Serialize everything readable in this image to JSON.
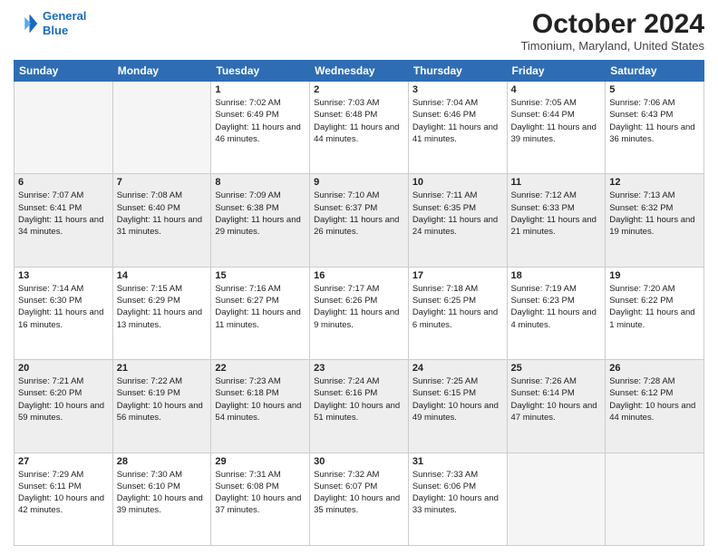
{
  "logo": {
    "line1": "General",
    "line2": "Blue"
  },
  "header": {
    "month": "October 2024",
    "location": "Timonium, Maryland, United States"
  },
  "weekdays": [
    "Sunday",
    "Monday",
    "Tuesday",
    "Wednesday",
    "Thursday",
    "Friday",
    "Saturday"
  ],
  "weeks": [
    [
      {
        "day": "",
        "sunrise": "",
        "sunset": "",
        "daylight": ""
      },
      {
        "day": "",
        "sunrise": "",
        "sunset": "",
        "daylight": ""
      },
      {
        "day": "1",
        "sunrise": "Sunrise: 7:02 AM",
        "sunset": "Sunset: 6:49 PM",
        "daylight": "Daylight: 11 hours and 46 minutes."
      },
      {
        "day": "2",
        "sunrise": "Sunrise: 7:03 AM",
        "sunset": "Sunset: 6:48 PM",
        "daylight": "Daylight: 11 hours and 44 minutes."
      },
      {
        "day": "3",
        "sunrise": "Sunrise: 7:04 AM",
        "sunset": "Sunset: 6:46 PM",
        "daylight": "Daylight: 11 hours and 41 minutes."
      },
      {
        "day": "4",
        "sunrise": "Sunrise: 7:05 AM",
        "sunset": "Sunset: 6:44 PM",
        "daylight": "Daylight: 11 hours and 39 minutes."
      },
      {
        "day": "5",
        "sunrise": "Sunrise: 7:06 AM",
        "sunset": "Sunset: 6:43 PM",
        "daylight": "Daylight: 11 hours and 36 minutes."
      }
    ],
    [
      {
        "day": "6",
        "sunrise": "Sunrise: 7:07 AM",
        "sunset": "Sunset: 6:41 PM",
        "daylight": "Daylight: 11 hours and 34 minutes."
      },
      {
        "day": "7",
        "sunrise": "Sunrise: 7:08 AM",
        "sunset": "Sunset: 6:40 PM",
        "daylight": "Daylight: 11 hours and 31 minutes."
      },
      {
        "day": "8",
        "sunrise": "Sunrise: 7:09 AM",
        "sunset": "Sunset: 6:38 PM",
        "daylight": "Daylight: 11 hours and 29 minutes."
      },
      {
        "day": "9",
        "sunrise": "Sunrise: 7:10 AM",
        "sunset": "Sunset: 6:37 PM",
        "daylight": "Daylight: 11 hours and 26 minutes."
      },
      {
        "day": "10",
        "sunrise": "Sunrise: 7:11 AM",
        "sunset": "Sunset: 6:35 PM",
        "daylight": "Daylight: 11 hours and 24 minutes."
      },
      {
        "day": "11",
        "sunrise": "Sunrise: 7:12 AM",
        "sunset": "Sunset: 6:33 PM",
        "daylight": "Daylight: 11 hours and 21 minutes."
      },
      {
        "day": "12",
        "sunrise": "Sunrise: 7:13 AM",
        "sunset": "Sunset: 6:32 PM",
        "daylight": "Daylight: 11 hours and 19 minutes."
      }
    ],
    [
      {
        "day": "13",
        "sunrise": "Sunrise: 7:14 AM",
        "sunset": "Sunset: 6:30 PM",
        "daylight": "Daylight: 11 hours and 16 minutes."
      },
      {
        "day": "14",
        "sunrise": "Sunrise: 7:15 AM",
        "sunset": "Sunset: 6:29 PM",
        "daylight": "Daylight: 11 hours and 13 minutes."
      },
      {
        "day": "15",
        "sunrise": "Sunrise: 7:16 AM",
        "sunset": "Sunset: 6:27 PM",
        "daylight": "Daylight: 11 hours and 11 minutes."
      },
      {
        "day": "16",
        "sunrise": "Sunrise: 7:17 AM",
        "sunset": "Sunset: 6:26 PM",
        "daylight": "Daylight: 11 hours and 9 minutes."
      },
      {
        "day": "17",
        "sunrise": "Sunrise: 7:18 AM",
        "sunset": "Sunset: 6:25 PM",
        "daylight": "Daylight: 11 hours and 6 minutes."
      },
      {
        "day": "18",
        "sunrise": "Sunrise: 7:19 AM",
        "sunset": "Sunset: 6:23 PM",
        "daylight": "Daylight: 11 hours and 4 minutes."
      },
      {
        "day": "19",
        "sunrise": "Sunrise: 7:20 AM",
        "sunset": "Sunset: 6:22 PM",
        "daylight": "Daylight: 11 hours and 1 minute."
      }
    ],
    [
      {
        "day": "20",
        "sunrise": "Sunrise: 7:21 AM",
        "sunset": "Sunset: 6:20 PM",
        "daylight": "Daylight: 10 hours and 59 minutes."
      },
      {
        "day": "21",
        "sunrise": "Sunrise: 7:22 AM",
        "sunset": "Sunset: 6:19 PM",
        "daylight": "Daylight: 10 hours and 56 minutes."
      },
      {
        "day": "22",
        "sunrise": "Sunrise: 7:23 AM",
        "sunset": "Sunset: 6:18 PM",
        "daylight": "Daylight: 10 hours and 54 minutes."
      },
      {
        "day": "23",
        "sunrise": "Sunrise: 7:24 AM",
        "sunset": "Sunset: 6:16 PM",
        "daylight": "Daylight: 10 hours and 51 minutes."
      },
      {
        "day": "24",
        "sunrise": "Sunrise: 7:25 AM",
        "sunset": "Sunset: 6:15 PM",
        "daylight": "Daylight: 10 hours and 49 minutes."
      },
      {
        "day": "25",
        "sunrise": "Sunrise: 7:26 AM",
        "sunset": "Sunset: 6:14 PM",
        "daylight": "Daylight: 10 hours and 47 minutes."
      },
      {
        "day": "26",
        "sunrise": "Sunrise: 7:28 AM",
        "sunset": "Sunset: 6:12 PM",
        "daylight": "Daylight: 10 hours and 44 minutes."
      }
    ],
    [
      {
        "day": "27",
        "sunrise": "Sunrise: 7:29 AM",
        "sunset": "Sunset: 6:11 PM",
        "daylight": "Daylight: 10 hours and 42 minutes."
      },
      {
        "day": "28",
        "sunrise": "Sunrise: 7:30 AM",
        "sunset": "Sunset: 6:10 PM",
        "daylight": "Daylight: 10 hours and 39 minutes."
      },
      {
        "day": "29",
        "sunrise": "Sunrise: 7:31 AM",
        "sunset": "Sunset: 6:08 PM",
        "daylight": "Daylight: 10 hours and 37 minutes."
      },
      {
        "day": "30",
        "sunrise": "Sunrise: 7:32 AM",
        "sunset": "Sunset: 6:07 PM",
        "daylight": "Daylight: 10 hours and 35 minutes."
      },
      {
        "day": "31",
        "sunrise": "Sunrise: 7:33 AM",
        "sunset": "Sunset: 6:06 PM",
        "daylight": "Daylight: 10 hours and 33 minutes."
      },
      {
        "day": "",
        "sunrise": "",
        "sunset": "",
        "daylight": ""
      },
      {
        "day": "",
        "sunrise": "",
        "sunset": "",
        "daylight": ""
      }
    ]
  ]
}
